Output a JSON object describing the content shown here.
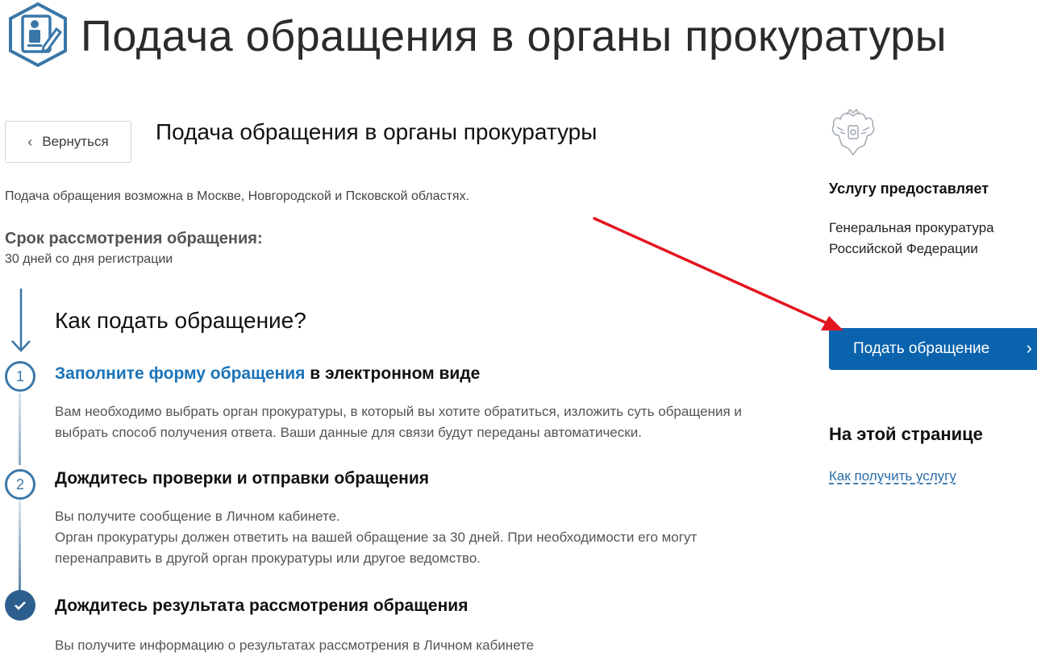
{
  "header": {
    "title": "Подача обращения в органы прокуратуры"
  },
  "nav": {
    "back_label": "Вернуться"
  },
  "service": {
    "title": "Подача обращения в органы прокуратуры",
    "availability": "Подача обращения возможна в Москве, Новгородской и Псковской областях.",
    "review_label": "Срок рассмотрения обращения:",
    "review_value": "30 дней со дня регистрации"
  },
  "howto": {
    "title": "Как подать обращение?",
    "steps": [
      {
        "number": "1",
        "link_text": "Заполните форму обращения",
        "title_rest": " в электронном виде",
        "lines": [
          "Вам необходимо выбрать орган прокуратуры, в который вы хотите обратиться, изложить суть обращения и",
          "выбрать способ получения ответа. Ваши данные для связи будут переданы автоматически."
        ]
      },
      {
        "number": "2",
        "title": "Дождитесь проверки и отправки обращения",
        "lines": [
          "Вы получите сообщение в Личном кабинете.",
          "Орган прокуратуры должен ответить на вашей обращение за 30 дней. При необходимости его могут",
          "перенаправить в другой орган прокуратуры или другое ведомство."
        ]
      },
      {
        "icon": "checkmark-icon",
        "title": "Дождитесь результата рассмотрения обращения",
        "lines": [
          "Вы получите информацию о результатах рассмотрения в Личном кабинете"
        ]
      }
    ]
  },
  "sidebar": {
    "provider_label": "Услугу предоставляет",
    "provider_name_line1": "Генеральная прокуратура",
    "provider_name_line2": "Российской Федерации",
    "submit_label": "Подать обращение",
    "onpage_title": "На этой странице",
    "onpage_link": "Как получить услугу"
  },
  "colors": {
    "primary": "#0b63ad",
    "link": "#1a73b8",
    "step_accent": "#3a77a8",
    "annotation_arrow": "#e3151f"
  },
  "icons": {
    "header": "service-document-icon",
    "emblem": "coat-of-arms-icon",
    "back": "chevron-left-icon",
    "submit": "chevron-right-icon"
  }
}
